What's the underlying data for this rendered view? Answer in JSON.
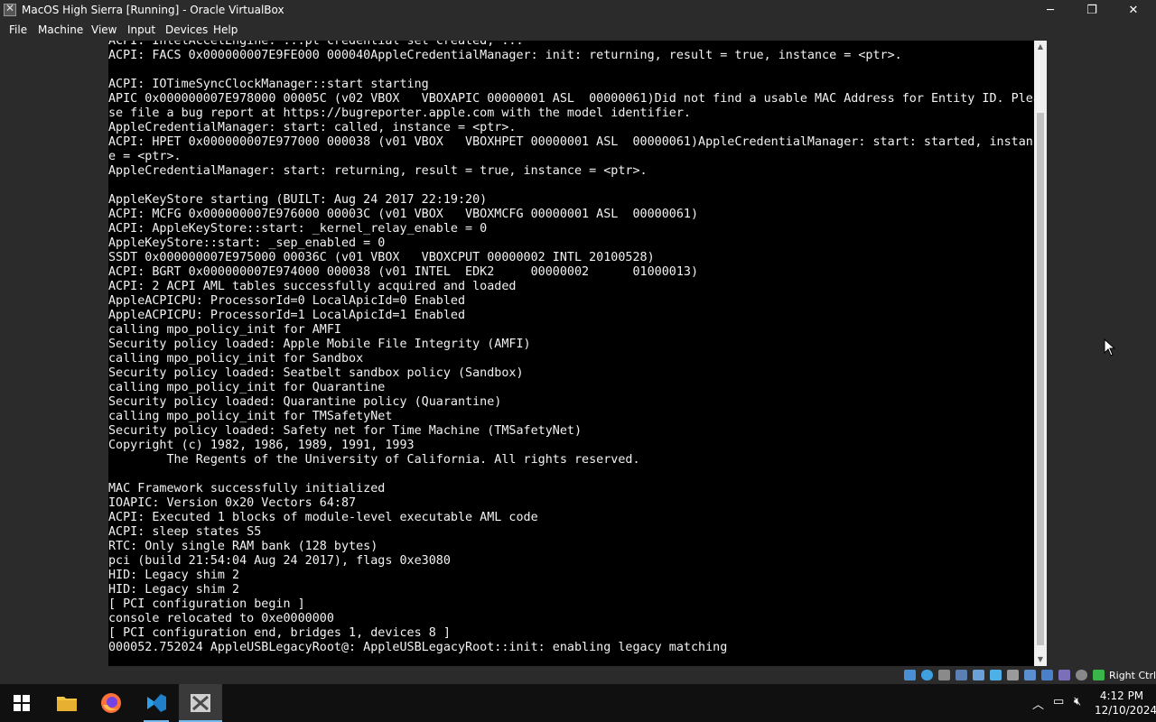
{
  "window": {
    "title": "MacOS High Sierra [Running] - Oracle VirtualBox",
    "minimize": "─",
    "maximize": "❐",
    "close": "✕"
  },
  "menu": [
    "File",
    "Machine",
    "View",
    "Input",
    "Devices",
    "Help"
  ],
  "console_lines": [
    "ACPI: IntelAccelEngine: ...pt credential set created, ...",
    "ACPI: FACS 0x000000007E9FE000 000040AppleCredentialManager: init: returning, result = true, instance = <ptr>.",
    "",
    "ACPI: IOTimeSyncClockManager::start starting",
    "APIC 0x000000007E978000 00005C (v02 VBOX   VBOXAPIC 00000001 ASL  00000061)Did not find a usable MAC Address for Entity ID. Plea",
    "se file a bug report at https://bugreporter.apple.com with the model identifier.",
    "AppleCredentialManager: start: called, instance = <ptr>.",
    "ACPI: HPET 0x000000007E977000 000038 (v01 VBOX   VBOXHPET 00000001 ASL  00000061)AppleCredentialManager: start: started, instanc",
    "e = <ptr>.",
    "AppleCredentialManager: start: returning, result = true, instance = <ptr>.",
    "",
    "AppleKeyStore starting (BUILT: Aug 24 2017 22:19:20)",
    "ACPI: MCFG 0x000000007E976000 00003C (v01 VBOX   VBOXMCFG 00000001 ASL  00000061)",
    "ACPI: AppleKeyStore::start: _kernel_relay_enable = 0",
    "AppleKeyStore::start: _sep_enabled = 0",
    "SSDT 0x000000007E975000 00036C (v01 VBOX   VBOXCPUT 00000002 INTL 20100528)",
    "ACPI: BGRT 0x000000007E974000 000038 (v01 INTEL  EDK2     00000002      01000013)",
    "ACPI: 2 ACPI AML tables successfully acquired and loaded",
    "AppleACPICPU: ProcessorId=0 LocalApicId=0 Enabled",
    "AppleACPICPU: ProcessorId=1 LocalApicId=1 Enabled",
    "calling mpo_policy_init for AMFI",
    "Security policy loaded: Apple Mobile File Integrity (AMFI)",
    "calling mpo_policy_init for Sandbox",
    "Security policy loaded: Seatbelt sandbox policy (Sandbox)",
    "calling mpo_policy_init for Quarantine",
    "Security policy loaded: Quarantine policy (Quarantine)",
    "calling mpo_policy_init for TMSafetyNet",
    "Security policy loaded: Safety net for Time Machine (TMSafetyNet)",
    "Copyright (c) 1982, 1986, 1989, 1991, 1993",
    "        The Regents of the University of California. All rights reserved.",
    "",
    "MAC Framework successfully initialized",
    "IOAPIC: Version 0x20 Vectors 64:87",
    "ACPI: Executed 1 blocks of module-level executable AML code",
    "ACPI: sleep states S5",
    "RTC: Only single RAM bank (128 bytes)",
    "pci (build 21:54:04 Aug 24 2017), flags 0xe3080",
    "HID: Legacy shim 2",
    "HID: Legacy shim 2",
    "[ PCI configuration begin ]",
    "console relocated to 0xe0000000",
    "[ PCI configuration end, bridges 1, devices 8 ]",
    "000052.752024 AppleUSBLegacyRoot@: AppleUSBLegacyRoot::init: enabling legacy matching"
  ],
  "status_icons": [
    "hard-disk-icon",
    "optical-disk-icon",
    "floppy-icon",
    "audio-icon",
    "network-icon",
    "usb-icon",
    "shared-folder-icon",
    "display-icon",
    "recording-icon",
    "cpu-icon",
    "mouse-integration-icon",
    "keyboard-icon"
  ],
  "host_key": "Right Ctrl",
  "taskbar": {
    "items": [
      "start-button",
      "file-explorer-button",
      "firefox-button",
      "visual-studio-button",
      "virtualbox-button"
    ],
    "clock_time": "4:12 PM",
    "clock_date": "12/10/2024"
  },
  "colors": {
    "console_bg": "#000000",
    "console_fg": "#f2f2f2",
    "chrome_bg": "#2b2b2b",
    "taskbar_bg": "#101010",
    "accent": "#76b9ed"
  }
}
